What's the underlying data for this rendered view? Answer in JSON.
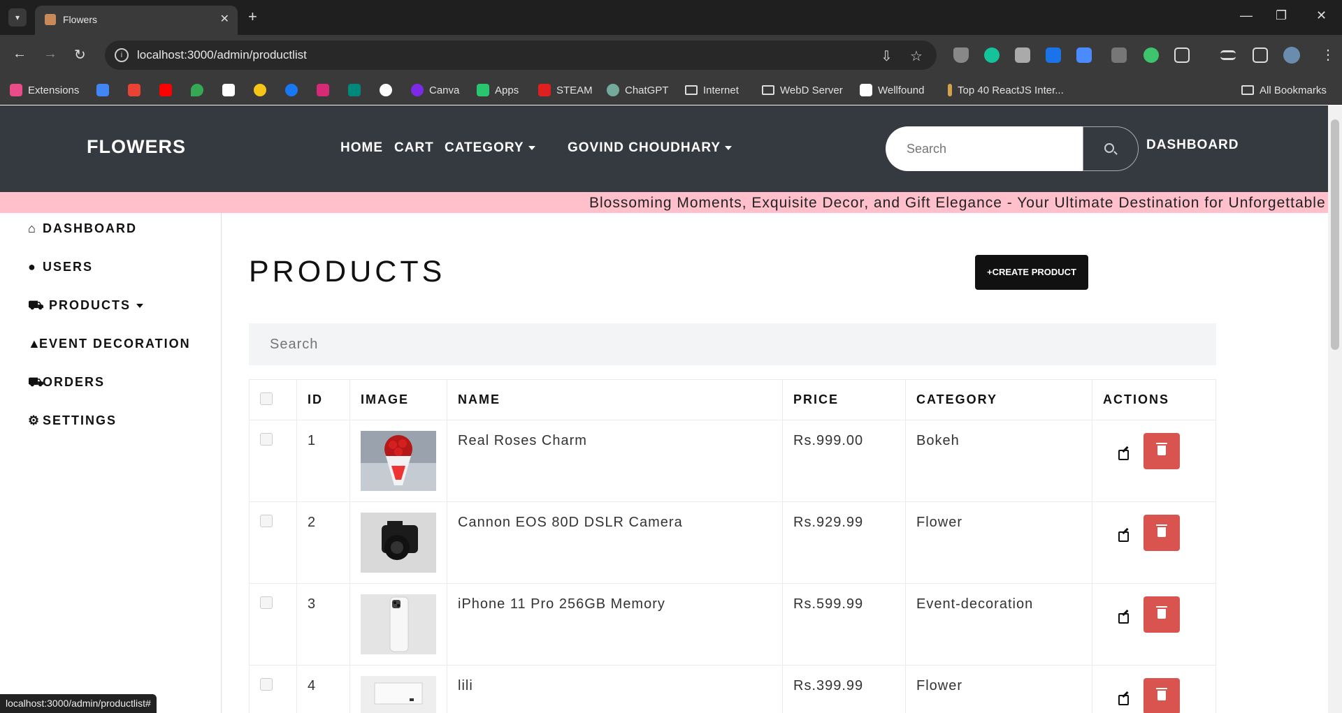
{
  "browser": {
    "tab_title": "Flowers",
    "url": "localhost:3000/admin/productlist",
    "bookmarks": [
      "Extensions",
      "Canva",
      "Apps",
      "STEAM",
      "ChatGPT",
      "Internet",
      "WebD Server",
      "Wellfound",
      "Top 40 ReactJS Inter...",
      "All Bookmarks"
    ],
    "status_url": "localhost:3000/admin/productlist#"
  },
  "navbar": {
    "brand": "FLOWERS",
    "links": [
      "HOME",
      "CART",
      "CATEGORY",
      "GOVIND CHOUDHARY"
    ],
    "search_placeholder": "Search",
    "dashboard": "DASHBOARD"
  },
  "marquee": "Blossoming Moments, Exquisite Decor, and Gift Elegance - Your Ultimate Destination for Unforgettable Ce",
  "sidebar": {
    "items": [
      "DASHBOARD",
      "USERS",
      "PRODUCTS",
      "EVENT DECORATION",
      "ORDERS",
      "SETTINGS"
    ]
  },
  "main": {
    "title": "PRODUCTS",
    "create_button": "CREATE PRODUCT",
    "search_placeholder": "Search",
    "columns": [
      "ID",
      "IMAGE",
      "NAME",
      "PRICE",
      "CATEGORY",
      "ACTIONS"
    ],
    "rows": [
      {
        "id": "1",
        "name": "Real Roses Charm",
        "price": "Rs.999.00",
        "category": "Bokeh"
      },
      {
        "id": "2",
        "name": "Cannon EOS 80D DSLR Camera",
        "price": "Rs.929.99",
        "category": "Flower"
      },
      {
        "id": "3",
        "name": "iPhone 11 Pro 256GB Memory",
        "price": "Rs.599.99",
        "category": "Event-decoration"
      },
      {
        "id": "4",
        "name": "lili",
        "price": "Rs.399.99",
        "category": "Flower"
      }
    ]
  }
}
